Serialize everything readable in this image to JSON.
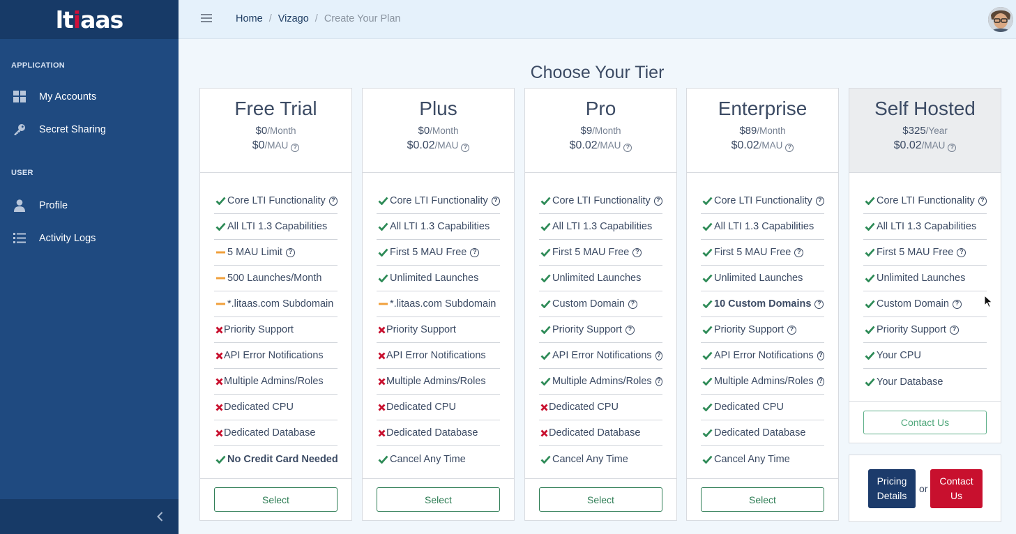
{
  "brand": {
    "logo_text_a": "lt",
    "logo_text_dot": "i",
    "logo_text_b": "aas"
  },
  "sidebar": {
    "sections": [
      {
        "title": "APPLICATION",
        "items": [
          {
            "label": "My Accounts",
            "icon": "dashboard-grid-icon"
          },
          {
            "label": "Secret Sharing",
            "icon": "key-icon"
          }
        ]
      },
      {
        "title": "USER",
        "items": [
          {
            "label": "Profile",
            "icon": "user-icon"
          },
          {
            "label": "Activity Logs",
            "icon": "list-icon"
          }
        ]
      }
    ]
  },
  "header": {
    "breadcrumb": [
      "Home",
      "Vizago",
      "Create Your Plan"
    ],
    "separator": "/"
  },
  "main": {
    "title": "Choose Your Tier",
    "select_label": "Select",
    "contact_label": "Contact Us",
    "tiers": [
      {
        "name": "Free Trial",
        "price": "$0",
        "price_unit": "/Month",
        "mau_price": "$0",
        "mau_unit": "/MAU",
        "features": [
          {
            "icon": "check",
            "text": "Core LTI Functionality",
            "help": true,
            "bold": false
          },
          {
            "icon": "check",
            "text": "All LTI 1.3 Capabilities",
            "help": false,
            "bold": false
          },
          {
            "icon": "dash",
            "text": "5 MAU Limit",
            "help": true,
            "bold": false
          },
          {
            "icon": "dash",
            "text": "500 Launches/Month",
            "help": false,
            "bold": false
          },
          {
            "icon": "dash",
            "text": "*.litaas.com Subdomain",
            "help": false,
            "bold": false
          },
          {
            "icon": "x",
            "text": "Priority Support",
            "help": false,
            "bold": false
          },
          {
            "icon": "x",
            "text": "API Error Notifications",
            "help": false,
            "bold": false
          },
          {
            "icon": "x",
            "text": "Multiple Admins/Roles",
            "help": false,
            "bold": false
          },
          {
            "icon": "x",
            "text": "Dedicated CPU",
            "help": false,
            "bold": false
          },
          {
            "icon": "x",
            "text": "Dedicated Database",
            "help": false,
            "bold": false
          },
          {
            "icon": "check",
            "text": "No Credit Card Needed",
            "help": false,
            "bold": true
          }
        ]
      },
      {
        "name": "Plus",
        "price": "$0",
        "price_unit": "/Month",
        "mau_price": "$0.02",
        "mau_unit": "/MAU",
        "features": [
          {
            "icon": "check",
            "text": "Core LTI Functionality",
            "help": true,
            "bold": false
          },
          {
            "icon": "check",
            "text": "All LTI 1.3 Capabilities",
            "help": false,
            "bold": false
          },
          {
            "icon": "check",
            "text": "First 5 MAU Free",
            "help": true,
            "bold": false
          },
          {
            "icon": "check",
            "text": "Unlimited Launches",
            "help": false,
            "bold": false
          },
          {
            "icon": "dash",
            "text": "*.litaas.com Subdomain",
            "help": false,
            "bold": false
          },
          {
            "icon": "x",
            "text": "Priority Support",
            "help": false,
            "bold": false
          },
          {
            "icon": "x",
            "text": "API Error Notifications",
            "help": false,
            "bold": false
          },
          {
            "icon": "x",
            "text": "Multiple Admins/Roles",
            "help": false,
            "bold": false
          },
          {
            "icon": "x",
            "text": "Dedicated CPU",
            "help": false,
            "bold": false
          },
          {
            "icon": "x",
            "text": "Dedicated Database",
            "help": false,
            "bold": false
          },
          {
            "icon": "check",
            "text": "Cancel Any Time",
            "help": false,
            "bold": false
          }
        ]
      },
      {
        "name": "Pro",
        "price": "$9",
        "price_unit": "/Month",
        "mau_price": "$0.02",
        "mau_unit": "/MAU",
        "features": [
          {
            "icon": "check",
            "text": "Core LTI Functionality",
            "help": true,
            "bold": false
          },
          {
            "icon": "check",
            "text": "All LTI 1.3 Capabilities",
            "help": false,
            "bold": false
          },
          {
            "icon": "check",
            "text": "First 5 MAU Free",
            "help": true,
            "bold": false
          },
          {
            "icon": "check",
            "text": "Unlimited Launches",
            "help": false,
            "bold": false
          },
          {
            "icon": "check",
            "text": "Custom Domain",
            "help": true,
            "bold": false
          },
          {
            "icon": "check",
            "text": "Priority Support",
            "help": true,
            "bold": false
          },
          {
            "icon": "check",
            "text": "API Error Notifications",
            "help": true,
            "bold": false
          },
          {
            "icon": "check",
            "text": "Multiple Admins/Roles",
            "help": true,
            "bold": false
          },
          {
            "icon": "x",
            "text": "Dedicated CPU",
            "help": false,
            "bold": false
          },
          {
            "icon": "x",
            "text": "Dedicated Database",
            "help": false,
            "bold": false
          },
          {
            "icon": "check",
            "text": "Cancel Any Time",
            "help": false,
            "bold": false
          }
        ]
      },
      {
        "name": "Enterprise",
        "price": "$89",
        "price_unit": "/Month",
        "mau_price": "$0.02",
        "mau_unit": "/MAU",
        "features": [
          {
            "icon": "check",
            "text": "Core LTI Functionality",
            "help": true,
            "bold": false
          },
          {
            "icon": "check",
            "text": "All LTI 1.3 Capabilities",
            "help": false,
            "bold": false
          },
          {
            "icon": "check",
            "text": "First 5 MAU Free",
            "help": true,
            "bold": false
          },
          {
            "icon": "check",
            "text": "Unlimited Launches",
            "help": false,
            "bold": false
          },
          {
            "icon": "check",
            "text": "10 Custom Domains",
            "help": true,
            "bold": true
          },
          {
            "icon": "check",
            "text": "Priority Support",
            "help": true,
            "bold": false
          },
          {
            "icon": "check",
            "text": "API Error Notifications",
            "help": true,
            "bold": false
          },
          {
            "icon": "check",
            "text": "Multiple Admins/Roles",
            "help": true,
            "bold": false
          },
          {
            "icon": "check",
            "text": "Dedicated CPU",
            "help": false,
            "bold": false
          },
          {
            "icon": "check",
            "text": "Dedicated Database",
            "help": false,
            "bold": false
          },
          {
            "icon": "check",
            "text": "Cancel Any Time",
            "help": false,
            "bold": false
          }
        ]
      },
      {
        "name": "Self Hosted",
        "price": "$325",
        "price_unit": "/Year",
        "mau_price": "$0.02",
        "mau_unit": "/MAU",
        "features": [
          {
            "icon": "check",
            "text": "Core LTI Functionality",
            "help": true,
            "bold": false
          },
          {
            "icon": "check",
            "text": "All LTI 1.3 Capabilities",
            "help": false,
            "bold": false
          },
          {
            "icon": "check",
            "text": "First 5 MAU Free",
            "help": true,
            "bold": false
          },
          {
            "icon": "check",
            "text": "Unlimited Launches",
            "help": false,
            "bold": false
          },
          {
            "icon": "check",
            "text": "Custom Domain",
            "help": true,
            "bold": false
          },
          {
            "icon": "check",
            "text": "Priority Support",
            "help": true,
            "bold": false
          },
          {
            "icon": "check",
            "text": "Your CPU",
            "help": false,
            "bold": false
          },
          {
            "icon": "check",
            "text": "Your Database",
            "help": false,
            "bold": false
          }
        ]
      }
    ],
    "info_box": {
      "pricing_line1": "Pricing",
      "pricing_line2": "Details",
      "or": "or",
      "contact_line1": "Contact",
      "contact_line2": "Us"
    }
  },
  "colors": {
    "sidebar": "#1f4a80",
    "sidebar_brand": "#173a67",
    "check": "#2e8b57",
    "dash": "#f0a03c",
    "x": "#c8102e",
    "pricing_button": "#1c3b6b",
    "contact_button": "#c8102e"
  }
}
